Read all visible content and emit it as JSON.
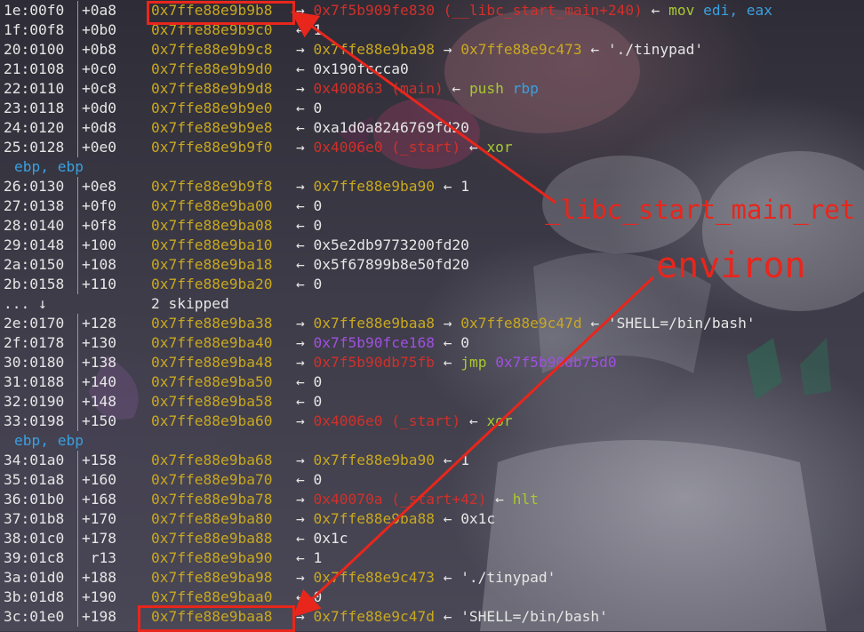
{
  "stack_rows": [
    {
      "idx": "1e:00f0",
      "off": "+0a8",
      "addr": "0x7ffe88e9b9b8",
      "rest": [
        {
          "t": "→ ",
          "c": "arrow"
        },
        {
          "t": "0x7f5b909fe830 (__libc_start_main+240)",
          "c": "red"
        },
        {
          "t": " ← ",
          "c": "arrow"
        },
        {
          "t": "mov ",
          "c": "green"
        },
        {
          "t": "edi, eax",
          "c": "blue"
        }
      ]
    },
    {
      "idx": "1f:00f8",
      "off": "+0b0",
      "addr": "0x7ffe88e9b9c0",
      "rest": [
        {
          "t": "← 1",
          "c": "white"
        }
      ]
    },
    {
      "idx": "20:0100",
      "off": "+0b8",
      "addr": "0x7ffe88e9b9c8",
      "rest": [
        {
          "t": "→ ",
          "c": "arrow"
        },
        {
          "t": "0x7ffe88e9ba98",
          "c": "addr"
        },
        {
          "t": " → ",
          "c": "arrow"
        },
        {
          "t": "0x7ffe88e9c473",
          "c": "addr"
        },
        {
          "t": " ← './tinypad'",
          "c": "white"
        }
      ]
    },
    {
      "idx": "21:0108",
      "off": "+0c0",
      "addr": "0x7ffe88e9b9d0",
      "rest": [
        {
          "t": "← 0x190fccca0",
          "c": "white"
        }
      ]
    },
    {
      "idx": "22:0110",
      "off": "+0c8",
      "addr": "0x7ffe88e9b9d8",
      "rest": [
        {
          "t": "→ ",
          "c": "arrow"
        },
        {
          "t": "0x400863 (main)",
          "c": "red"
        },
        {
          "t": " ← ",
          "c": "arrow"
        },
        {
          "t": "push ",
          "c": "green"
        },
        {
          "t": "rbp",
          "c": "blue"
        }
      ]
    },
    {
      "idx": "23:0118",
      "off": "+0d0",
      "addr": "0x7ffe88e9b9e0",
      "rest": [
        {
          "t": "← 0",
          "c": "white"
        }
      ]
    },
    {
      "idx": "24:0120",
      "off": "+0d8",
      "addr": "0x7ffe88e9b9e8",
      "rest": [
        {
          "t": "← 0xa1d0a8246769fd20",
          "c": "white"
        }
      ]
    },
    {
      "idx": "25:0128",
      "off": "+0e0",
      "addr": "0x7ffe88e9b9f0",
      "rest": [
        {
          "t": "→ ",
          "c": "arrow"
        },
        {
          "t": "0x4006e0 (_start)",
          "c": "red"
        },
        {
          "t": " ← ",
          "c": "arrow"
        },
        {
          "t": "xor",
          "c": "green"
        }
      ]
    },
    {
      "wrap": "ebp, ebp"
    },
    {
      "idx": "26:0130",
      "off": "+0e8",
      "addr": "0x7ffe88e9b9f8",
      "rest": [
        {
          "t": "→ ",
          "c": "arrow"
        },
        {
          "t": "0x7ffe88e9ba90",
          "c": "addr"
        },
        {
          "t": " ← 1",
          "c": "white"
        }
      ]
    },
    {
      "idx": "27:0138",
      "off": "+0f0",
      "addr": "0x7ffe88e9ba00",
      "rest": [
        {
          "t": "← 0",
          "c": "white"
        }
      ]
    },
    {
      "idx": "28:0140",
      "off": "+0f8",
      "addr": "0x7ffe88e9ba08",
      "rest": [
        {
          "t": "← 0",
          "c": "white"
        }
      ]
    },
    {
      "idx": "29:0148",
      "off": "+100",
      "addr": "0x7ffe88e9ba10",
      "rest": [
        {
          "t": "← 0x5e2db9773200fd20",
          "c": "white"
        }
      ]
    },
    {
      "idx": "2a:0150",
      "off": "+108",
      "addr": "0x7ffe88e9ba18",
      "rest": [
        {
          "t": "← 0x5f67899b8e50fd20",
          "c": "white"
        }
      ]
    },
    {
      "idx": "2b:0158",
      "off": "+110",
      "addr": "0x7ffe88e9ba20",
      "rest": [
        {
          "t": "← 0",
          "c": "white"
        }
      ]
    },
    {
      "skip": "2 skipped",
      "skipidx": "... ↓"
    },
    {
      "idx": "2e:0170",
      "off": "+128",
      "addr": "0x7ffe88e9ba38",
      "rest": [
        {
          "t": "→ ",
          "c": "arrow"
        },
        {
          "t": "0x7ffe88e9baa8",
          "c": "addr"
        },
        {
          "t": " → ",
          "c": "arrow"
        },
        {
          "t": "0x7ffe88e9c47d",
          "c": "addr"
        },
        {
          "t": " ← 'SHELL=/bin/bash'",
          "c": "white"
        }
      ]
    },
    {
      "idx": "2f:0178",
      "off": "+130",
      "addr": "0x7ffe88e9ba40",
      "rest": [
        {
          "t": "→ ",
          "c": "arrow"
        },
        {
          "t": "0x7f5b90fce168",
          "c": "purple"
        },
        {
          "t": " ← 0",
          "c": "white"
        }
      ]
    },
    {
      "idx": "30:0180",
      "off": "+138",
      "addr": "0x7ffe88e9ba48",
      "rest": [
        {
          "t": "→ ",
          "c": "arrow"
        },
        {
          "t": "0x7f5b90db75fb",
          "c": "red"
        },
        {
          "t": " ← ",
          "c": "arrow"
        },
        {
          "t": "jmp ",
          "c": "green"
        },
        {
          "t": "0x7f5b90db75d0",
          "c": "purple"
        }
      ]
    },
    {
      "idx": "31:0188",
      "off": "+140",
      "addr": "0x7ffe88e9ba50",
      "rest": [
        {
          "t": "← 0",
          "c": "white"
        }
      ]
    },
    {
      "idx": "32:0190",
      "off": "+148",
      "addr": "0x7ffe88e9ba58",
      "rest": [
        {
          "t": "← 0",
          "c": "white"
        }
      ]
    },
    {
      "idx": "33:0198",
      "off": "+150",
      "addr": "0x7ffe88e9ba60",
      "rest": [
        {
          "t": "→ ",
          "c": "arrow"
        },
        {
          "t": "0x4006e0 (_start)",
          "c": "red"
        },
        {
          "t": " ← ",
          "c": "arrow"
        },
        {
          "t": "xor",
          "c": "green"
        }
      ]
    },
    {
      "wrap": "ebp, ebp"
    },
    {
      "idx": "34:01a0",
      "off": "+158",
      "addr": "0x7ffe88e9ba68",
      "rest": [
        {
          "t": "→ ",
          "c": "arrow"
        },
        {
          "t": "0x7ffe88e9ba90",
          "c": "addr"
        },
        {
          "t": " ← 1",
          "c": "white"
        }
      ]
    },
    {
      "idx": "35:01a8",
      "off": "+160",
      "addr": "0x7ffe88e9ba70",
      "rest": [
        {
          "t": "← 0",
          "c": "white"
        }
      ]
    },
    {
      "idx": "36:01b0",
      "off": "+168",
      "addr": "0x7ffe88e9ba78",
      "rest": [
        {
          "t": "→ ",
          "c": "arrow"
        },
        {
          "t": "0x40070a (_start+42)",
          "c": "red"
        },
        {
          "t": " ← ",
          "c": "arrow"
        },
        {
          "t": "hlt",
          "c": "green"
        }
      ]
    },
    {
      "idx": "37:01b8",
      "off": "+170",
      "addr": "0x7ffe88e9ba80",
      "rest": [
        {
          "t": "→ ",
          "c": "arrow"
        },
        {
          "t": "0x7ffe88e9ba88",
          "c": "addr"
        },
        {
          "t": " ← 0x1c",
          "c": "white"
        }
      ]
    },
    {
      "idx": "38:01c0",
      "off": "+178",
      "addr": "0x7ffe88e9ba88",
      "rest": [
        {
          "t": "← 0x1c",
          "c": "white"
        }
      ]
    },
    {
      "idx": "39:01c8",
      "off": " r13",
      "addr": "0x7ffe88e9ba90",
      "rest": [
        {
          "t": "← 1",
          "c": "white"
        }
      ]
    },
    {
      "idx": "3a:01d0",
      "off": "+188",
      "addr": "0x7ffe88e9ba98",
      "rest": [
        {
          "t": "→ ",
          "c": "arrow"
        },
        {
          "t": "0x7ffe88e9c473",
          "c": "addr"
        },
        {
          "t": " ← './tinypad'",
          "c": "white"
        }
      ]
    },
    {
      "idx": "3b:01d8",
      "off": "+190",
      "addr": "0x7ffe88e9baa0",
      "rest": [
        {
          "t": "← 0",
          "c": "white"
        }
      ]
    },
    {
      "idx": "3c:01e0",
      "off": "+198",
      "addr": "0x7ffe88e9baa8",
      "rest": [
        {
          "t": "→ ",
          "c": "arrow"
        },
        {
          "t": "0x7ffe88e9c47d",
          "c": "addr"
        },
        {
          "t": " ← 'SHELL=/bin/bash'",
          "c": "white"
        }
      ]
    }
  ],
  "annotations": {
    "libc_label": "_libc_start_main_ret",
    "environ_label": "environ",
    "accent_color": "#e8261c"
  }
}
